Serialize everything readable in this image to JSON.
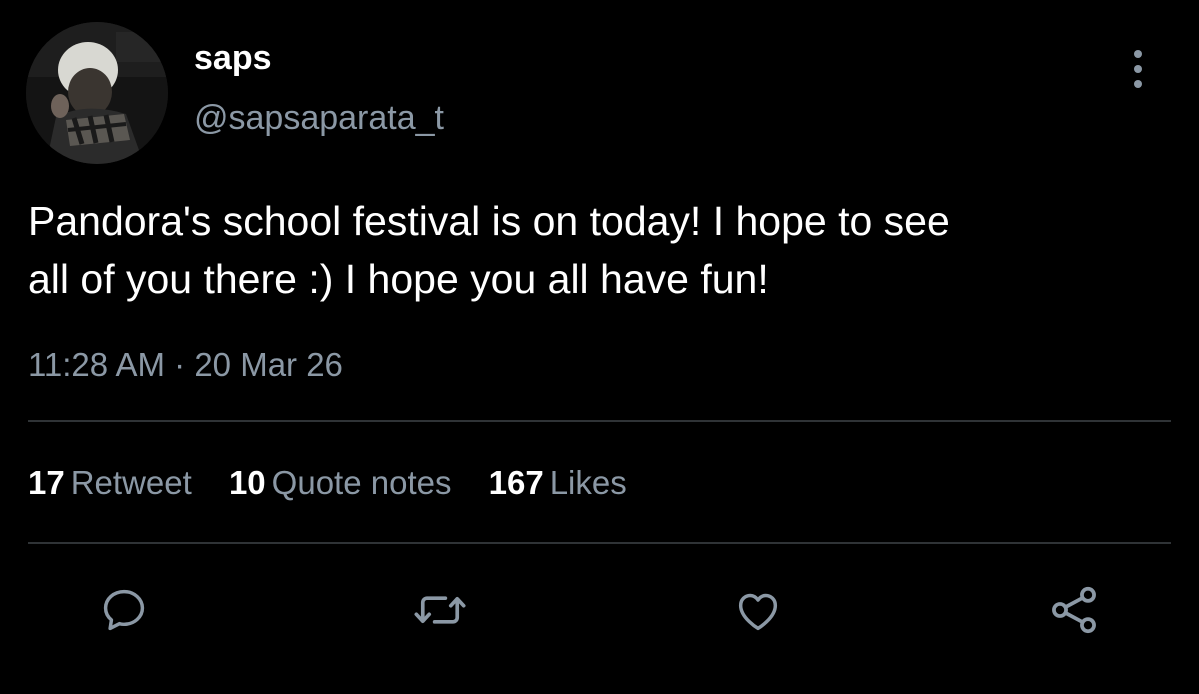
{
  "author": {
    "display_name": "saps",
    "handle": "@sapsaparata_t"
  },
  "tweet": {
    "text": "Pandora's school festival is on today! I hope to see\nall of you there :) I hope you all have fun!",
    "time": "11:28 AM",
    "separator": "·",
    "date": "20 Mar 26"
  },
  "stats": {
    "retweets": {
      "count": "17",
      "label": "Retweet"
    },
    "quotes": {
      "count": "10",
      "label": "Quote notes"
    },
    "likes": {
      "count": "167",
      "label": "Likes"
    }
  },
  "actions": [
    "reply-icon",
    "retweet-icon",
    "like-icon",
    "share-icon"
  ],
  "colors": {
    "background": "#000000",
    "primary_text": "#ffffff",
    "secondary_text": "#8b98a5",
    "divider": "#2f3336"
  }
}
